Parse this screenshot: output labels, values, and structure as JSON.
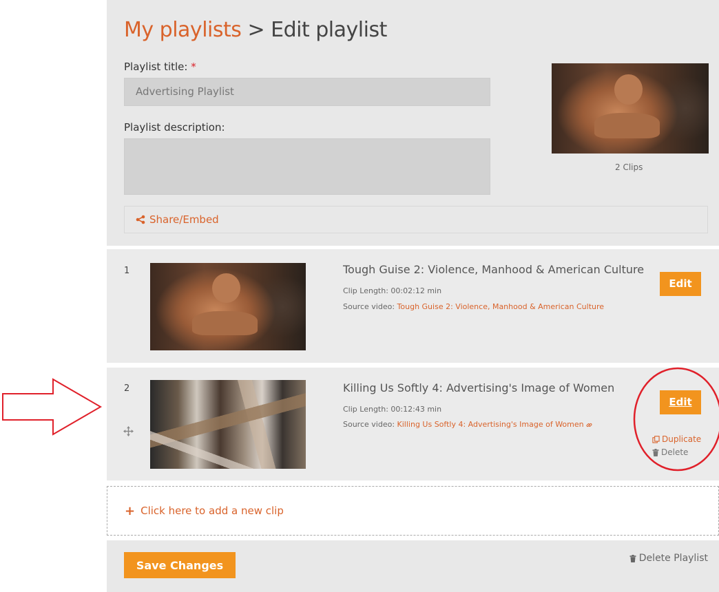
{
  "breadcrumb": {
    "parent": "My playlists",
    "separator": ">",
    "current": "Edit playlist"
  },
  "form": {
    "title_label": "Playlist title:",
    "required_mark": "*",
    "title_value": "Advertising Playlist",
    "description_label": "Playlist description:",
    "description_value": "",
    "clips_count": "2 Clips"
  },
  "share": {
    "icon": "share-icon",
    "label": "Share/Embed"
  },
  "clips": [
    {
      "number": "1",
      "title": "Tough Guise 2: Violence, Manhood & American Culture",
      "length_label": "Clip Length:",
      "length": "00:02:12 min",
      "source_label": "Source video:",
      "source": "Tough Guise 2: Violence, Manhood & American Culture",
      "edit_label": "Edit"
    },
    {
      "number": "2",
      "title": "Killing Us Softly 4: Advertising's Image of Women",
      "length_label": "Clip Length:",
      "length": "00:12:43 min",
      "source_label": "Source video:",
      "source": "Killing Us Softly 4: Advertising's Image of Women",
      "edit_label": "Edit",
      "duplicate_label": "Duplicate",
      "delete_label": "Delete"
    }
  ],
  "add_clip": {
    "icon": "plus-icon",
    "label": "Click here to add a new clip"
  },
  "footer": {
    "save_label": "Save Changes",
    "delete_playlist_label": "Delete Playlist"
  },
  "colors": {
    "accent": "#d9632b",
    "button": "#f2941e",
    "annotation": "#e0202a"
  }
}
